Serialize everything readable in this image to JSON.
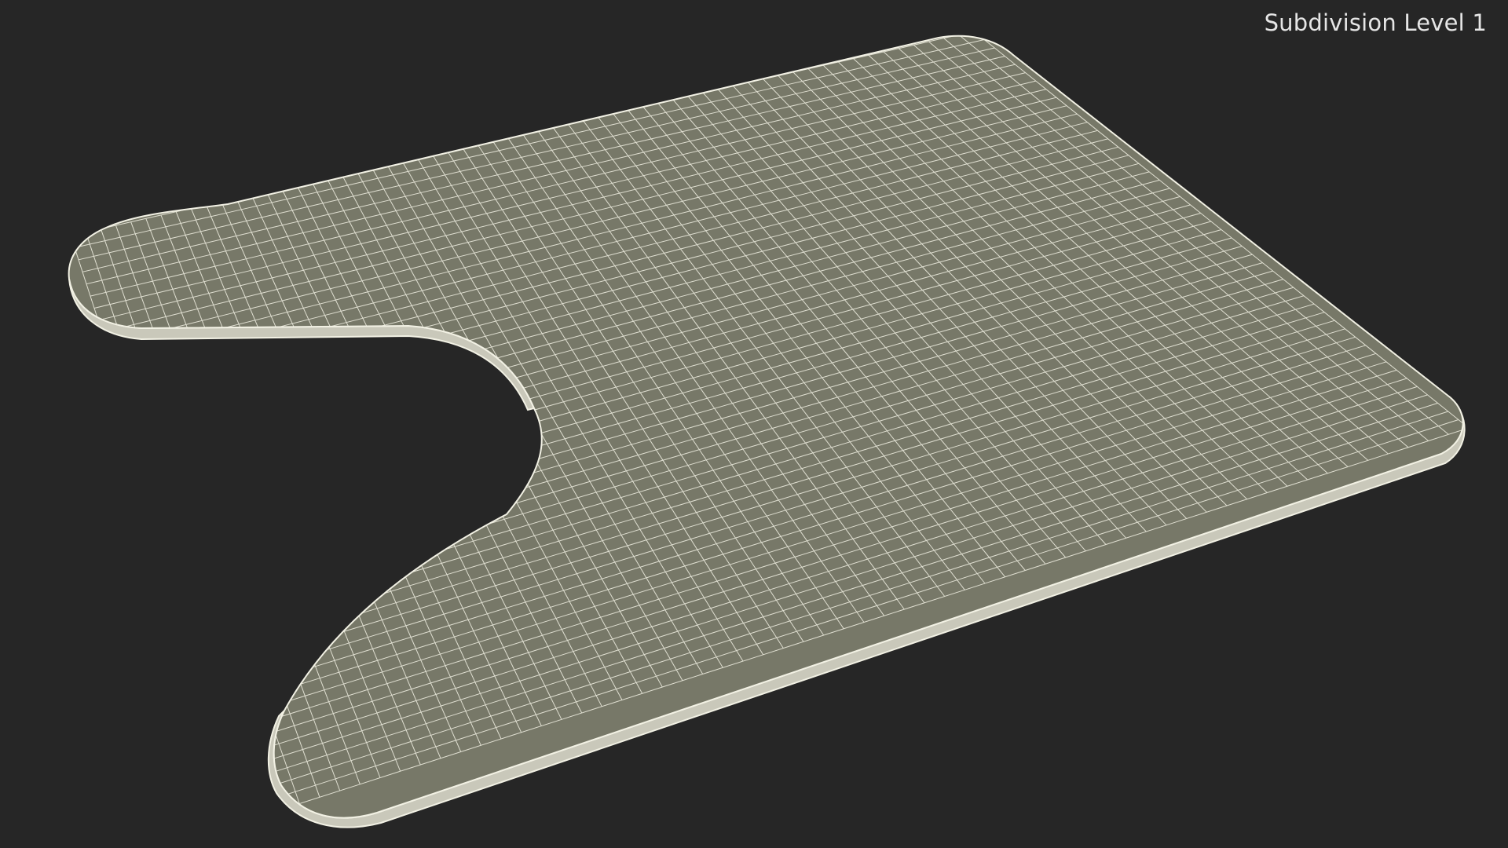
{
  "viewport": {
    "label": "Subdivision Level 1",
    "background_color": "#262626",
    "mesh_fill_color": "#777868",
    "wire_color": "#f2f1e4",
    "rim_color": "#c9c8ba"
  },
  "model": {
    "shape": "u-shaped-contour-mat",
    "display": "wireframe-on-shaded"
  }
}
